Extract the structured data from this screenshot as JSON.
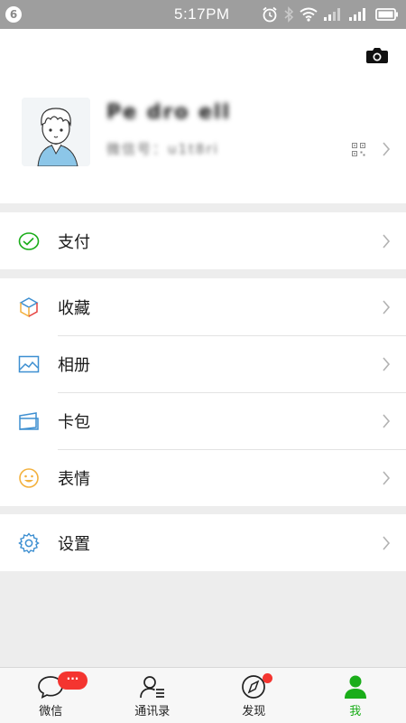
{
  "status_bar": {
    "badge": "6",
    "time": "5:17PM"
  },
  "profile": {
    "nickname": "Pe dro ell",
    "wechat_id": "微信号：u1t8ri"
  },
  "menu": {
    "pay": "支付",
    "favorites": "收藏",
    "album": "相册",
    "cards": "卡包",
    "stickers": "表情",
    "settings": "设置"
  },
  "tabs": {
    "chats": "微信",
    "contacts": "通讯录",
    "discover": "发现",
    "me": "我",
    "chats_badge": "···"
  },
  "colors": {
    "accent_green": "#1aad19",
    "badge_red": "#f43530",
    "icon_blue": "#3d8fd1"
  }
}
